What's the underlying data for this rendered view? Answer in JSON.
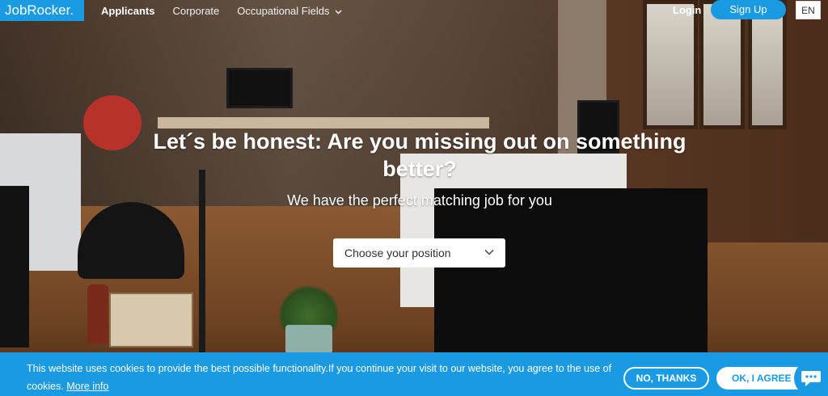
{
  "header": {
    "logo": "JobRocker.",
    "nav": [
      {
        "label": "Applicants",
        "active": true
      },
      {
        "label": "Corporate",
        "active": false
      },
      {
        "label": "Occupational Fields",
        "active": false,
        "has_dropdown": true
      }
    ],
    "login_label": "Login",
    "signup_label": "Sign Up",
    "language": "EN"
  },
  "hero": {
    "headline": "Let´s be honest: Are you missing out on something better?",
    "subline": "We have the perfect matching job for you",
    "select_placeholder": "Choose your position"
  },
  "cookie": {
    "text": "This website uses cookies to provide the best possible functionality.If you continue your visit to our website, you agree to the use of cookies.",
    "link_label": "More info",
    "decline_label": "NO, THANKS",
    "accept_label": "OK, I AGREE"
  },
  "colors": {
    "brand_blue": "#1a9ae2",
    "white": "#ffffff"
  },
  "icons": {
    "nav_dropdown": "chevron-down-icon",
    "select_dropdown": "chevron-down-icon",
    "chat": "chat-icon"
  }
}
